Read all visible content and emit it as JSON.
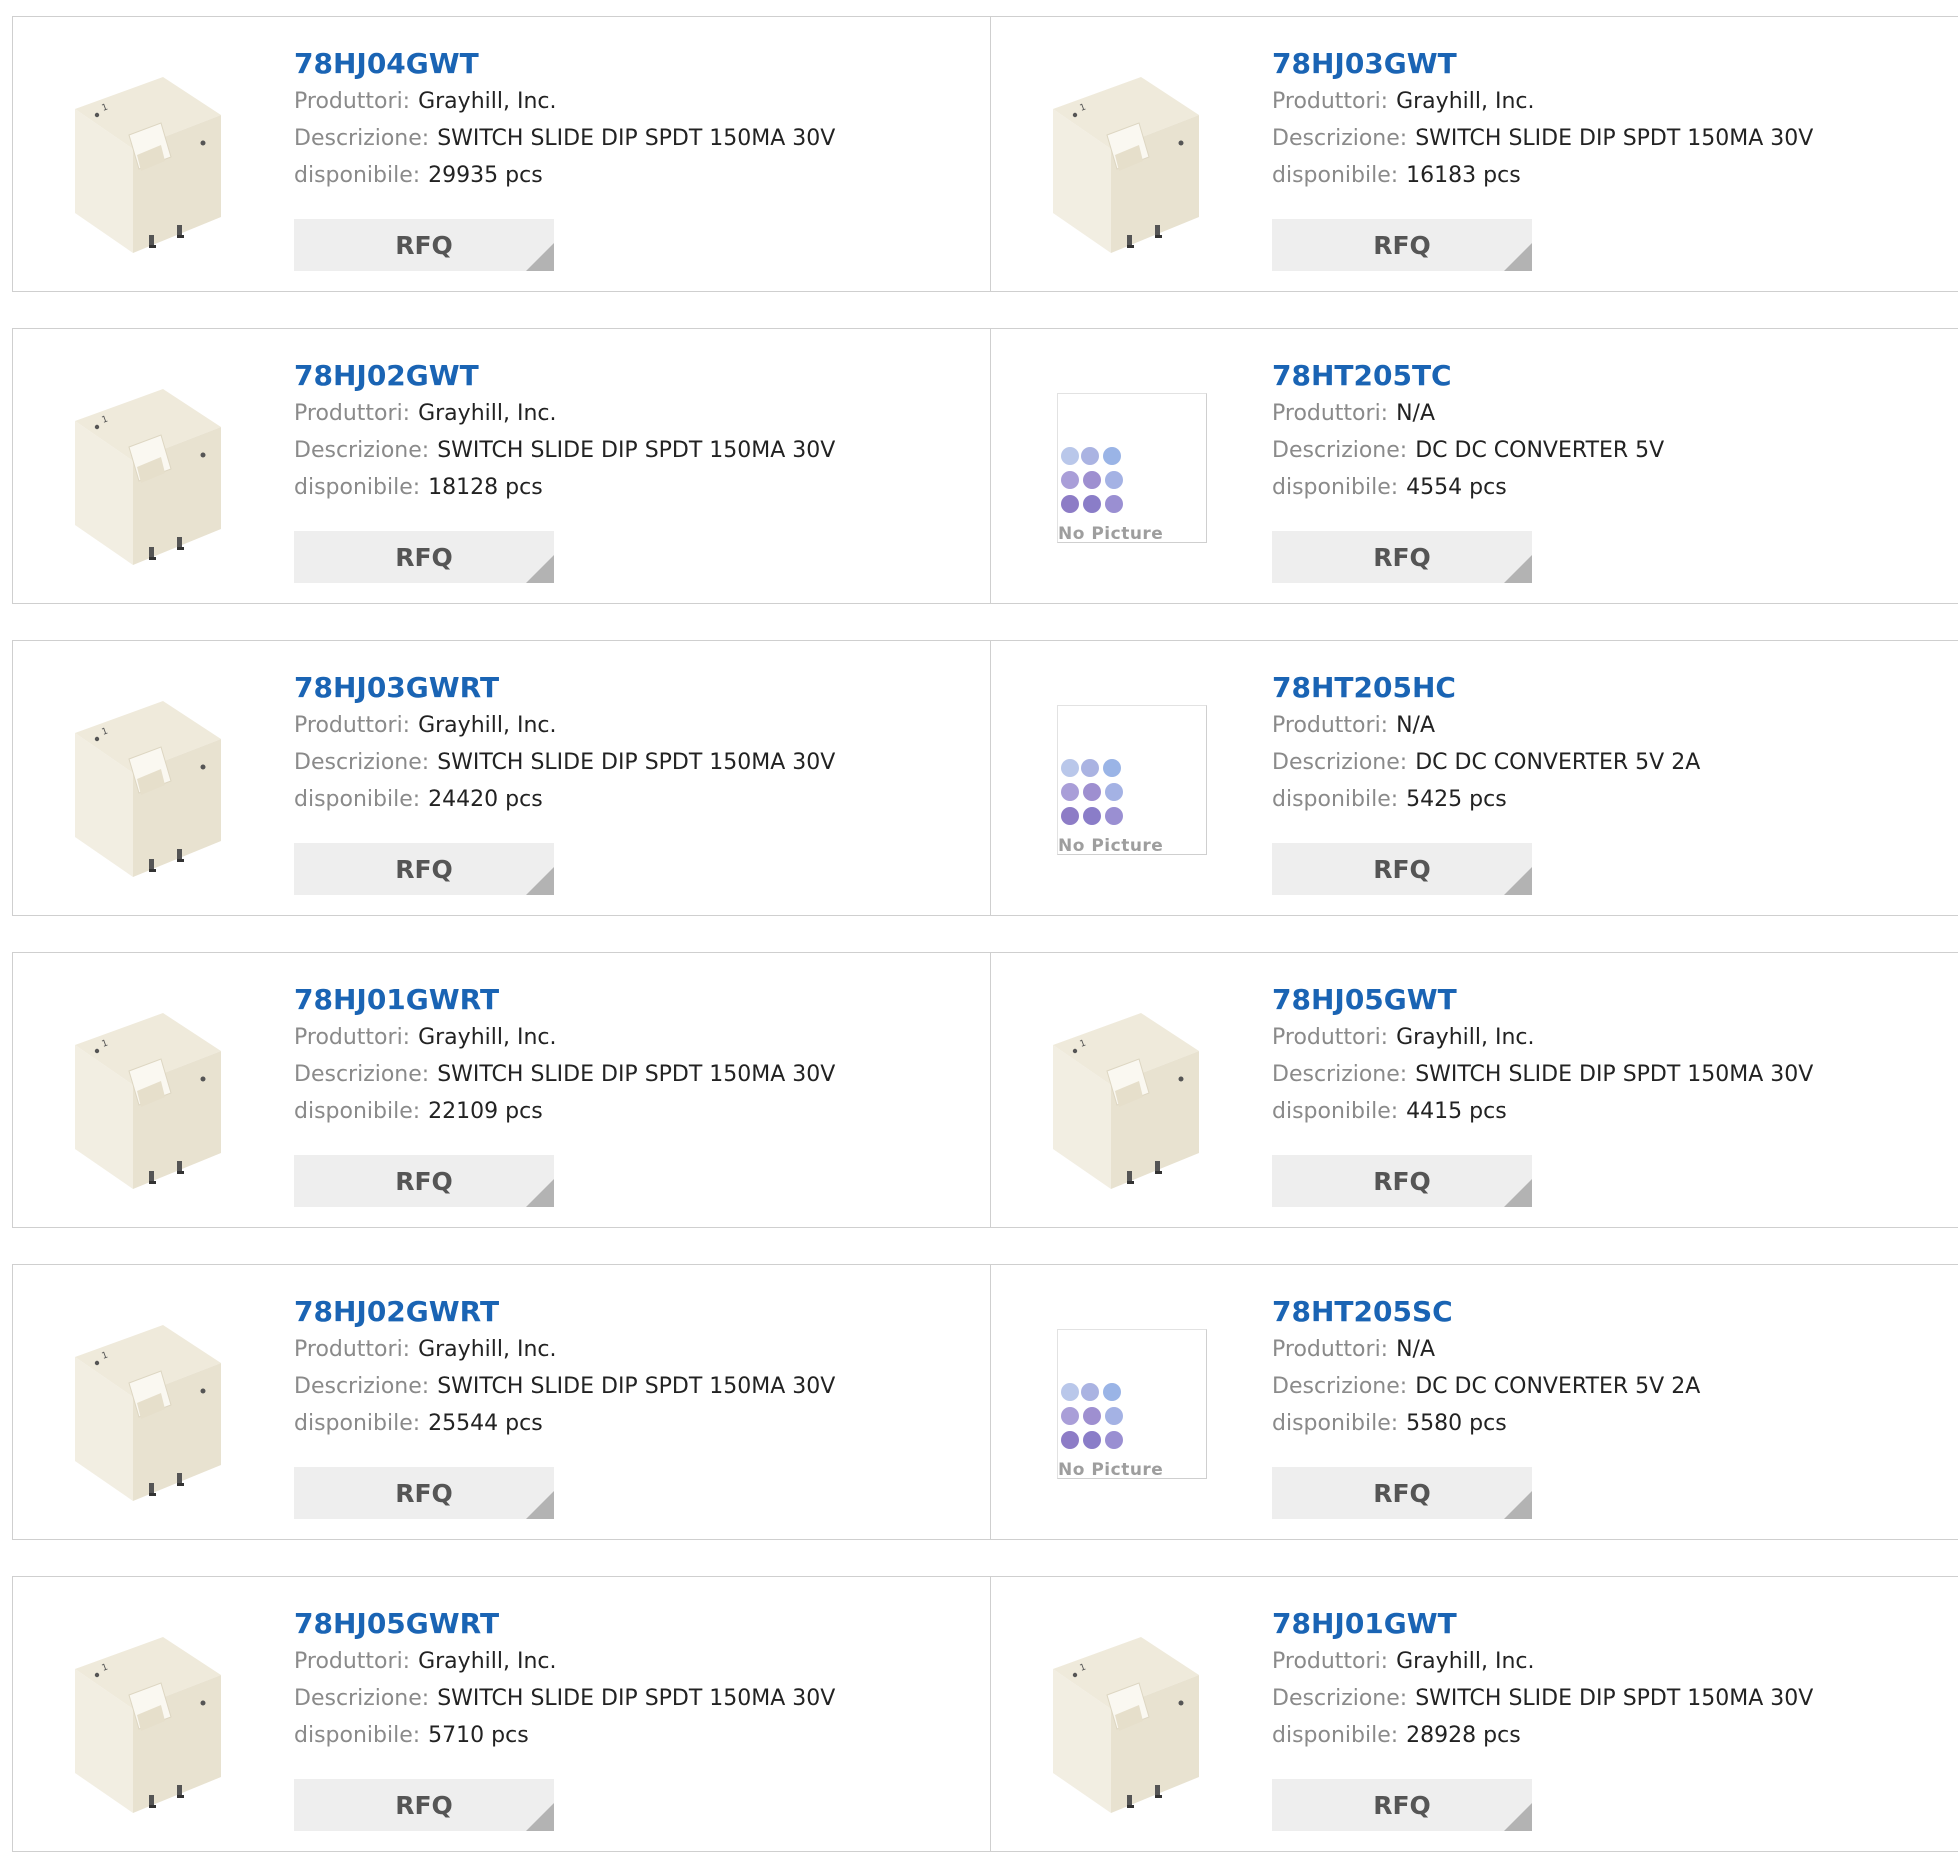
{
  "labels": {
    "manufacturer": "Produttori:",
    "description": "Descrizione:",
    "available": "disponibile:",
    "rfq": "RFQ",
    "no_picture": "No Picture"
  },
  "colors": {
    "title": "#1a64b4",
    "label": "#8a8a8a",
    "button_bg": "#eeeeee",
    "button_text": "#555555"
  },
  "products": [
    {
      "part": "78HJ04GWT",
      "manufacturer": "Grayhill, Inc.",
      "description": "SWITCH SLIDE DIP SPDT 150MA 30V",
      "available": "29935 pcs",
      "image": "switch"
    },
    {
      "part": "78HJ03GWT",
      "manufacturer": "Grayhill, Inc.",
      "description": "SWITCH SLIDE DIP SPDT 150MA 30V",
      "available": "16183 pcs",
      "image": "switch"
    },
    {
      "part": "78HJ02GWT",
      "manufacturer": "Grayhill, Inc.",
      "description": "SWITCH SLIDE DIP SPDT 150MA 30V",
      "available": "18128 pcs",
      "image": "switch"
    },
    {
      "part": "78HT205TC",
      "manufacturer": "N/A",
      "description": "DC DC CONVERTER 5V",
      "available": "4554 pcs",
      "image": "none"
    },
    {
      "part": "78HJ03GWRT",
      "manufacturer": "Grayhill, Inc.",
      "description": "SWITCH SLIDE DIP SPDT 150MA 30V",
      "available": "24420 pcs",
      "image": "switch"
    },
    {
      "part": "78HT205HC",
      "manufacturer": "N/A",
      "description": "DC DC CONVERTER 5V 2A",
      "available": "5425 pcs",
      "image": "none"
    },
    {
      "part": "78HJ01GWRT",
      "manufacturer": "Grayhill, Inc.",
      "description": "SWITCH SLIDE DIP SPDT 150MA 30V",
      "available": "22109 pcs",
      "image": "switch"
    },
    {
      "part": "78HJ05GWT",
      "manufacturer": "Grayhill, Inc.",
      "description": "SWITCH SLIDE DIP SPDT 150MA 30V",
      "available": "4415 pcs",
      "image": "switch"
    },
    {
      "part": "78HJ02GWRT",
      "manufacturer": "Grayhill, Inc.",
      "description": "SWITCH SLIDE DIP SPDT 150MA 30V",
      "available": "25544 pcs",
      "image": "switch"
    },
    {
      "part": "78HT205SC",
      "manufacturer": "N/A",
      "description": "DC DC CONVERTER 5V 2A",
      "available": "5580 pcs",
      "image": "none"
    },
    {
      "part": "78HJ05GWRT",
      "manufacturer": "Grayhill, Inc.",
      "description": "SWITCH SLIDE DIP SPDT 150MA 30V",
      "available": "5710 pcs",
      "image": "switch"
    },
    {
      "part": "78HJ01GWT",
      "manufacturer": "Grayhill, Inc.",
      "description": "SWITCH SLIDE DIP SPDT 150MA 30V",
      "available": "28928 pcs",
      "image": "switch"
    }
  ]
}
